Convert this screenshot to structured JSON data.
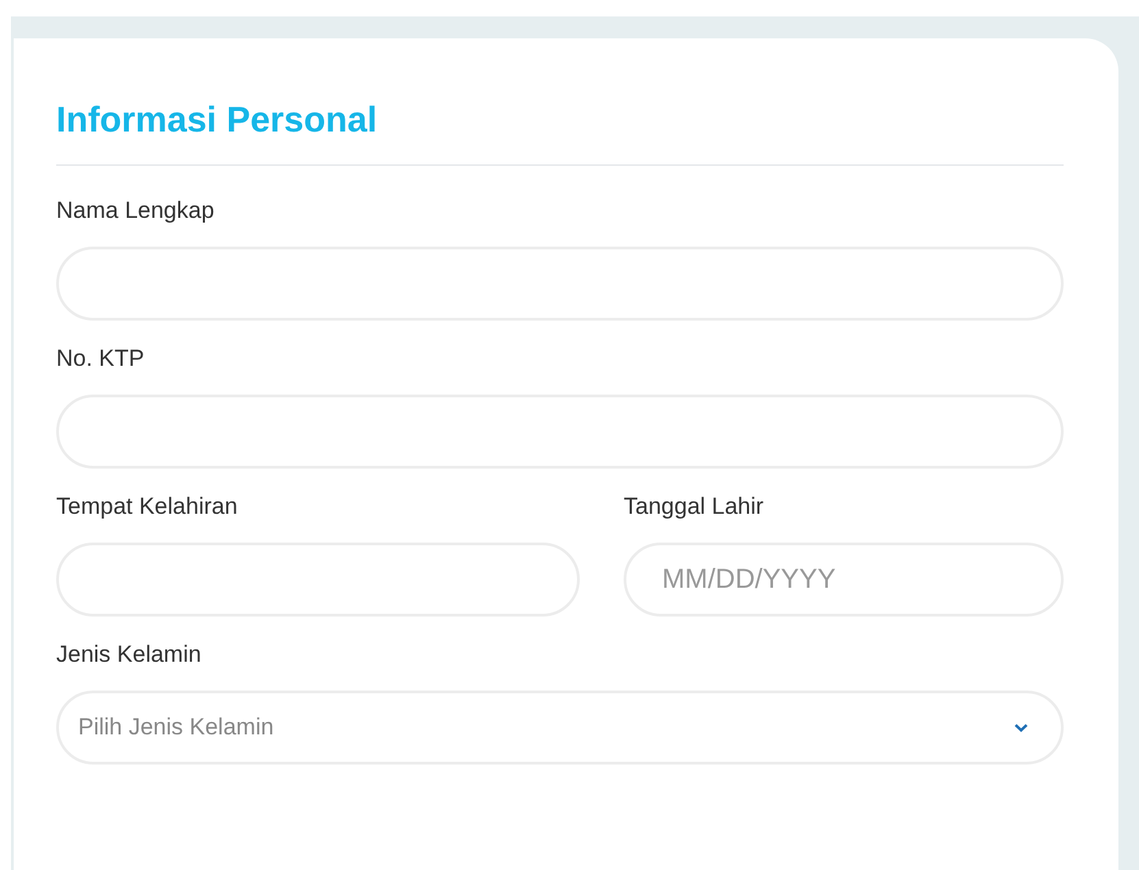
{
  "section": {
    "title": "Informasi Personal"
  },
  "rows": [
    {
      "fields": [
        {
          "label": "Nama Lengkap",
          "kind": "text"
        }
      ]
    },
    {
      "fields": [
        {
          "label": "No. KTP",
          "kind": "text"
        }
      ]
    },
    {
      "fields": [
        {
          "label": "Tempat Kelahiran",
          "kind": "text"
        },
        {
          "label": "Tanggal Lahir",
          "kind": "date",
          "placeholder": "MM/DD/YYYY"
        }
      ]
    },
    {
      "fields": [
        {
          "label": "Jenis Kelamin",
          "kind": "select",
          "placeholder": "Pilih Jenis Kelamin"
        }
      ]
    }
  ]
}
